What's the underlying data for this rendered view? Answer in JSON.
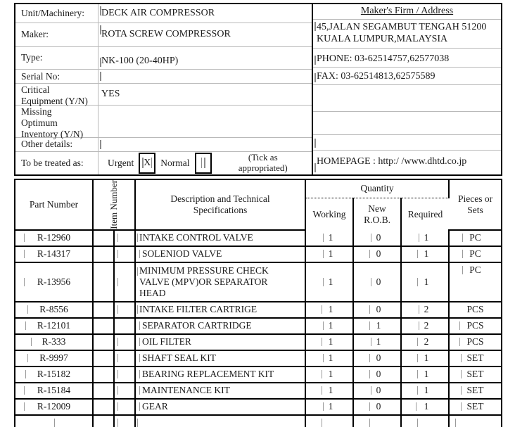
{
  "header": {
    "fields": [
      {
        "label": "Unit/Machinery:",
        "value": "DECK AIR COMPRESSOR"
      },
      {
        "label": "Maker:",
        "value": "ROTA SCREW COMPRESSOR"
      },
      {
        "label": "Type:",
        "value": "NK-100 (20-40HP)"
      },
      {
        "label": "Serial No:",
        "value": ""
      },
      {
        "label": "Critical Equipment (Y/N)",
        "label_line1": "Critical",
        "label_line2": "Equipment (Y/N)",
        "value": "YES"
      },
      {
        "label": "Missing Optimum Inventory (Y/N)",
        "label_line1": "Missing",
        "label_line2": "Optimum",
        "label_line3": "Inventory (Y/N)",
        "value": ""
      },
      {
        "label": "Other details:",
        "value": ""
      }
    ],
    "treat": {
      "label": "To be treated as:",
      "urgent_label": "Urgent",
      "urgent_mark": "X",
      "normal_label": "Normal",
      "normal_mark": "",
      "note_line1": "(Tick as",
      "note_line2": "appropriated)"
    }
  },
  "maker": {
    "title": "Maker's Firm / Address",
    "address_line1": "45,JALAN SEGAMBUT TENGAH 51200",
    "address_line2": "KUALA LUMPUR,MALAYSIA",
    "phone": "PHONE: 03-62514757,62577038",
    "fax": "FAX:  03-62514813,62575589",
    "homepage": "HOMEPAGE : http:/ /www.dhtd.co.jp"
  },
  "parts_table": {
    "columns": {
      "part_number": "Part Number",
      "item_number": "Item Number",
      "item_number_line1": "Item",
      "item_number_line2": "Number",
      "description_line1": "Description and Technical",
      "description_line2": "Specifications",
      "quantity": "Quantity",
      "working": "Working",
      "new_rob_line1": "New",
      "new_rob_line2": "R.O.B.",
      "required": "Required",
      "pieces_line1": "Pieces or",
      "pieces_line2": "Sets"
    },
    "rows": [
      {
        "part_number": "R-12960",
        "item_number": "",
        "description": "INTAKE CONTROL VALVE",
        "working": "1",
        "new_rob": "0",
        "required": "1",
        "unit": "PC"
      },
      {
        "part_number": "R-14317",
        "item_number": "",
        "description": "SOLENIOD VALVE",
        "working": "1",
        "new_rob": "0",
        "required": "1",
        "unit": "PC"
      },
      {
        "part_number": "R-13956",
        "item_number": "",
        "description": "MINIMUM PRESSURE CHECK VALVE (MPV)OR SEPARATOR HEAD",
        "description_line1": "MINIMUM PRESSURE CHECK",
        "description_line2": "VALVE (MPV)OR SEPARATOR",
        "description_line3": "HEAD",
        "working": "1",
        "new_rob": "0",
        "required": "1",
        "unit": "PC"
      },
      {
        "part_number": "R-8556",
        "item_number": "",
        "description": "INTAKE FILTER CARTRIGE",
        "working": "1",
        "new_rob": "0",
        "required": "2",
        "unit": "PCS"
      },
      {
        "part_number": "R-12101",
        "item_number": "",
        "description": "SEPARATOR CARTRIDGE",
        "working": "1",
        "new_rob": "1",
        "required": "2",
        "unit": "PCS"
      },
      {
        "part_number": "R-333",
        "item_number": "",
        "description": "OIL FILTER",
        "working": "1",
        "new_rob": "1",
        "required": "2",
        "unit": "PCS"
      },
      {
        "part_number": "R-9997",
        "item_number": "",
        "description": "SHAFT SEAL KIT",
        "working": "1",
        "new_rob": "0",
        "required": "1",
        "unit": "SET"
      },
      {
        "part_number": "R-15182",
        "item_number": "",
        "description": "BEARING REPLACEMENT KIT",
        "working": "1",
        "new_rob": "0",
        "required": "1",
        "unit": "SET"
      },
      {
        "part_number": "R-15184",
        "item_number": "",
        "description": "MAINTENANCE KIT",
        "working": "1",
        "new_rob": "0",
        "required": "1",
        "unit": "SET"
      },
      {
        "part_number": "R-12009",
        "item_number": "",
        "description": "GEAR",
        "working": "1",
        "new_rob": "0",
        "required": "1",
        "unit": "SET"
      },
      {
        "part_number": "",
        "item_number": "",
        "description": "",
        "working": "",
        "new_rob": "",
        "required": "",
        "unit": ""
      }
    ]
  }
}
